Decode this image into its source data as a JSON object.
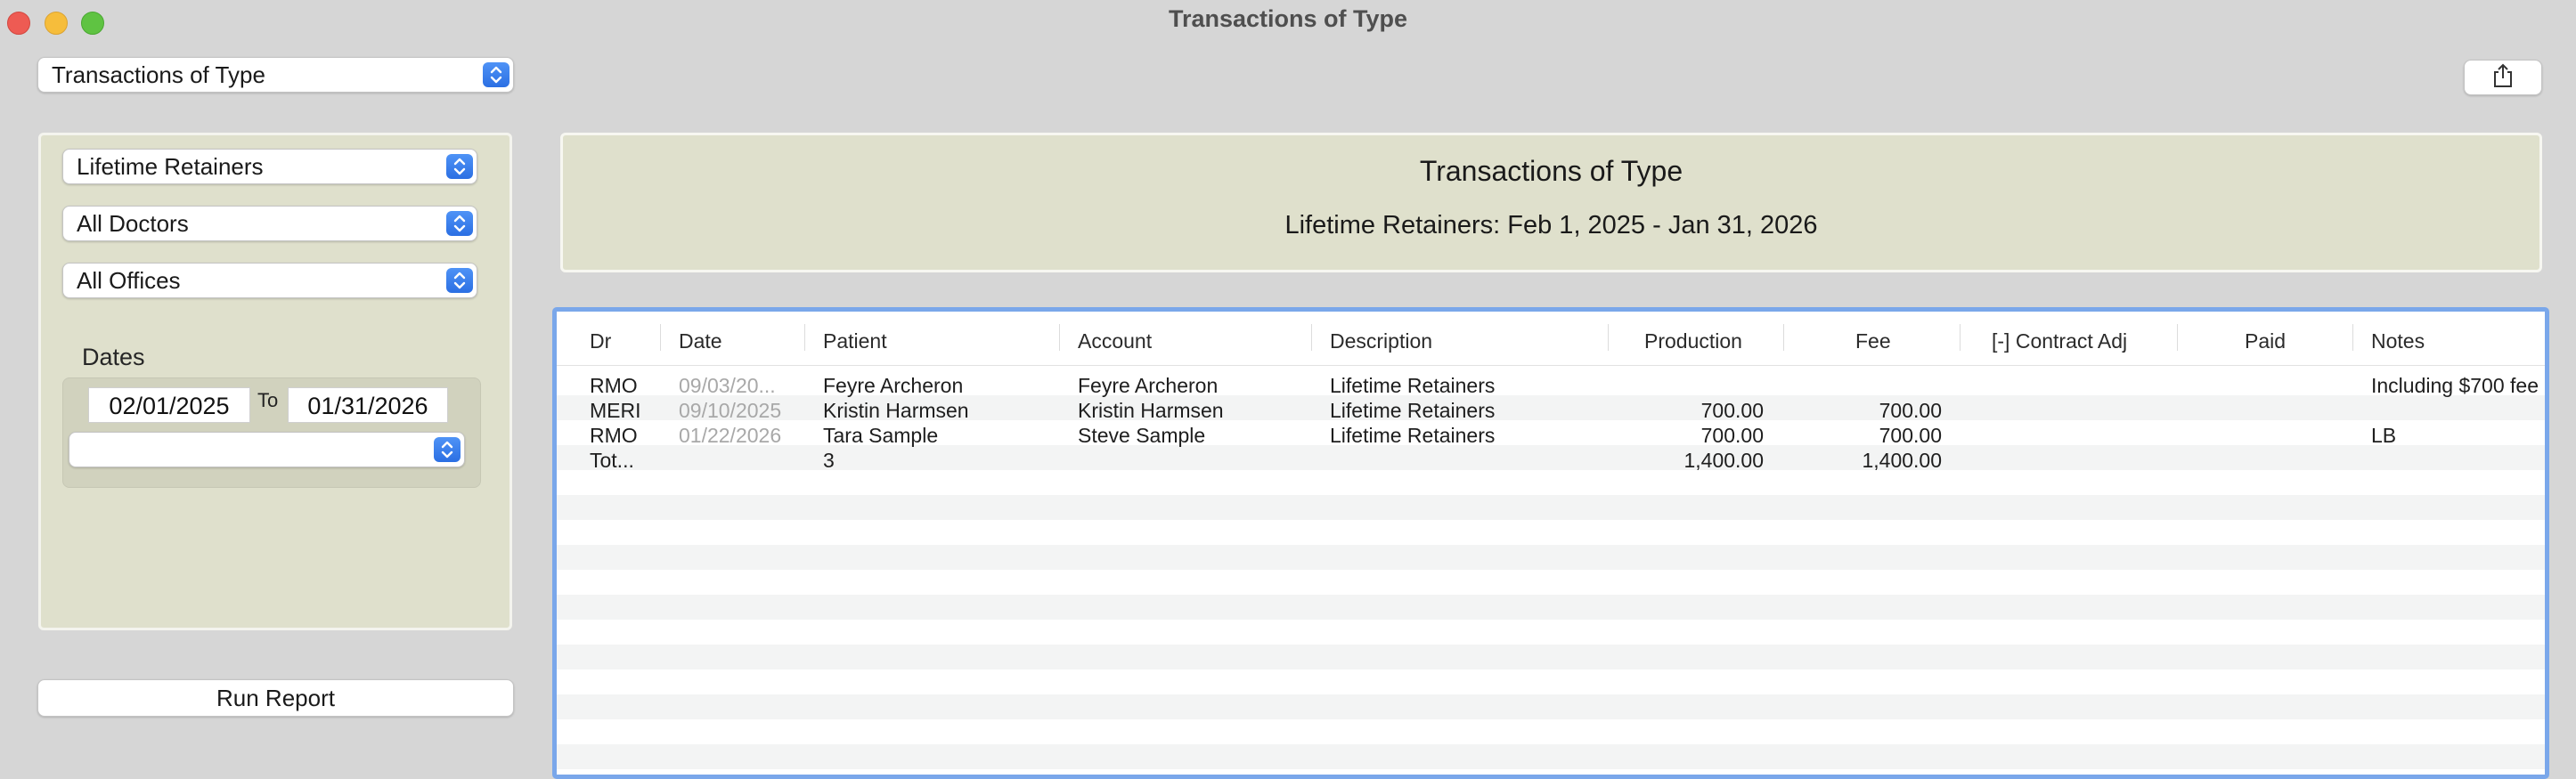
{
  "window": {
    "title": "Transactions of Type"
  },
  "report_selector": {
    "value": "Transactions of Type"
  },
  "filters": {
    "type": "Lifetime Retainers",
    "doctor": "All Doctors",
    "office": "All Offices",
    "dates_label": "Dates",
    "date_from": "02/01/2025",
    "to_label": "To",
    "date_to": "01/31/2026",
    "date_preset": ""
  },
  "run_button": "Run Report",
  "report": {
    "title": "Transactions of Type",
    "subtitle": "Lifetime Retainers: Feb 1, 2025 - Jan 31, 2026"
  },
  "table": {
    "columns": [
      "Dr",
      "Date",
      "Patient",
      "Account",
      "Description",
      "Production",
      "Fee",
      "[-] Contract Adj",
      "Paid",
      "Notes"
    ],
    "rows": [
      {
        "dr": "RMO",
        "date": "09/03/20...",
        "patient": "Feyre Archeron",
        "account": "Feyre Archeron",
        "description": "Lifetime Retainers",
        "production": "",
        "fee": "",
        "contract_adj": "",
        "paid": "",
        "notes": "Including $700 fee"
      },
      {
        "dr": "MERI",
        "date": "09/10/2025",
        "patient": "Kristin Harmsen",
        "account": "Kristin Harmsen",
        "description": "Lifetime Retainers",
        "production": "700.00",
        "fee": "700.00",
        "contract_adj": "",
        "paid": "",
        "notes": ""
      },
      {
        "dr": "RMO",
        "date": "01/22/2026",
        "patient": "Tara Sample",
        "account": "Steve Sample",
        "description": "Lifetime Retainers",
        "production": "700.00",
        "fee": "700.00",
        "contract_adj": "",
        "paid": "",
        "notes": "LB"
      }
    ],
    "totals": {
      "dr": "Tot...",
      "patient": "3",
      "production": "1,400.00",
      "fee": "1,400.00"
    }
  },
  "colors": {
    "panel": "#dfe0cc",
    "accent": "#2b6fe3",
    "table_border": "#7aa7ea",
    "stripe": "#f3f4f4"
  }
}
